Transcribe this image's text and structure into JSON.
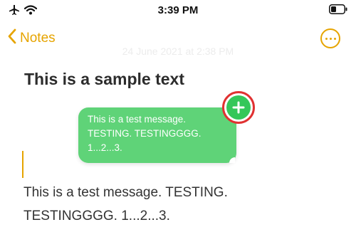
{
  "status_bar": {
    "time": "3:39 PM",
    "icons": [
      "airplane-icon",
      "wifi-icon",
      "battery-icon"
    ]
  },
  "nav": {
    "back_label": "Notes",
    "more_icon": "ellipsis-icon"
  },
  "note": {
    "date": "24 June 2021 at 2:38 PM",
    "title": "This is a sample text",
    "body_line_1": "This is a test message. TESTING.",
    "body_line_2": "TESTINGGGG. 1...2...3."
  },
  "drag_preview": {
    "line_1": "This is a test message.",
    "line_2": "TESTING. TESTINGGGG.",
    "line_3": "1...2...3.",
    "add_icon": "plus-icon"
  },
  "colors": {
    "accent": "#e6a400",
    "bubble": "#5fd378",
    "add_badge": "#34c759",
    "highlight_ring": "#e03131"
  }
}
